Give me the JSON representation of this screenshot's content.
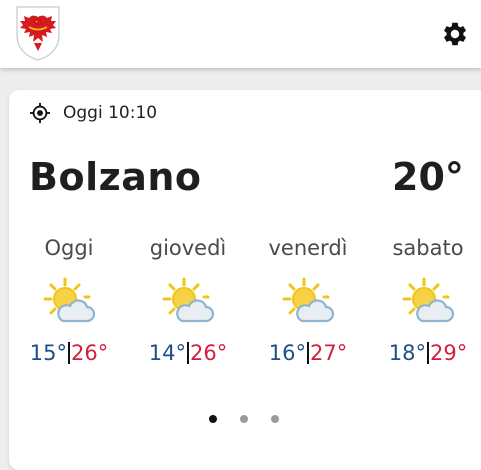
{
  "header": {
    "logo": "south-tyrol-coat-of-arms",
    "settings_icon": "gear-icon"
  },
  "location": {
    "icon": "location-crosshair-icon",
    "time_label": "Oggi 10:10"
  },
  "current": {
    "city": "Bolzano",
    "temperature": "20°"
  },
  "forecast": [
    {
      "day": "Oggi",
      "icon": "partly-sunny-icon",
      "min": "15°",
      "max": "26°"
    },
    {
      "day": "giovedì",
      "icon": "partly-sunny-icon",
      "min": "14°",
      "max": "26°"
    },
    {
      "day": "venerdì",
      "icon": "partly-sunny-icon",
      "min": "16°",
      "max": "27°"
    },
    {
      "day": "sabato",
      "icon": "partly-sunny-icon",
      "min": "18°",
      "max": "29°"
    }
  ],
  "pager": {
    "pages": 3,
    "active_index": 0
  },
  "colors": {
    "min_temp": "#1e4f8a",
    "max_temp": "#d21f3c",
    "sun": "#f2c416",
    "cloud": "#8fb4d1",
    "crest_red": "#d71920"
  }
}
